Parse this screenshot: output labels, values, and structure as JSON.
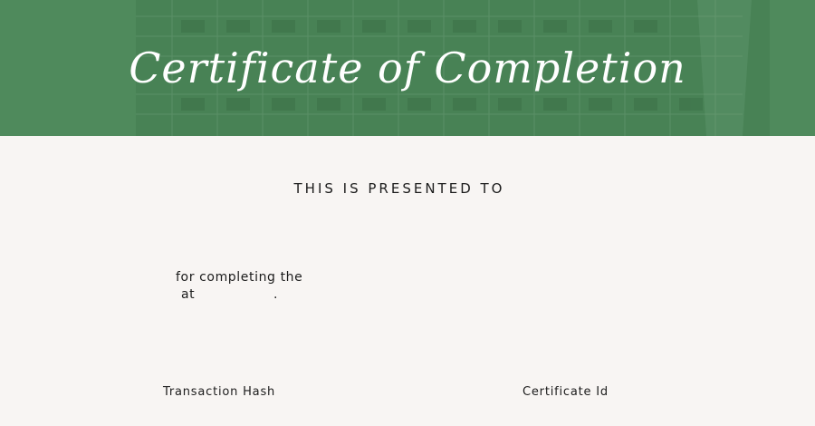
{
  "certificate": {
    "title": "Certificate of Completion",
    "presented_to": "THIS IS PRESENTED TO",
    "completing_text": "for completing the",
    "at_text": "at",
    "at_period": ".",
    "transaction_hash_label": "Transaction Hash",
    "certificate_id_label": "Certificate Id"
  },
  "colors": {
    "banner_green": "#4f8a5c",
    "paper": "#f8f5f3",
    "text_dark": "#1c1c1c",
    "title_white": "#ffffff"
  },
  "icons": {
    "banner_image": "building-facade-photo"
  }
}
